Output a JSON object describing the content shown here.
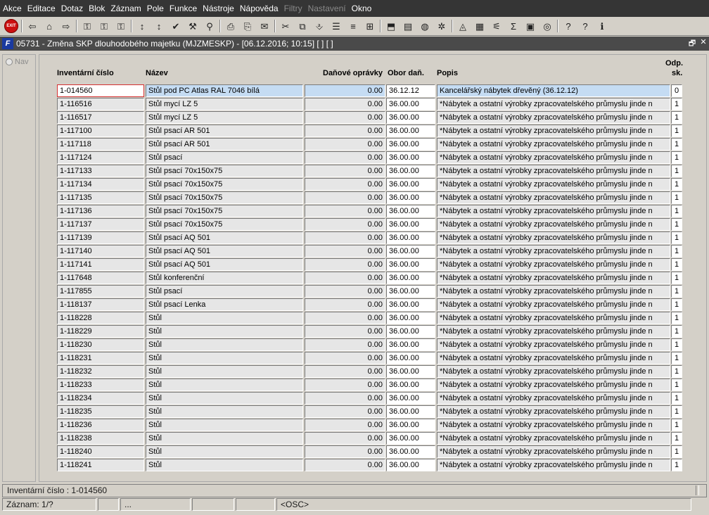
{
  "menu": [
    {
      "label": "Akce",
      "enabled": true
    },
    {
      "label": "Editace",
      "enabled": true
    },
    {
      "label": "Dotaz",
      "enabled": true
    },
    {
      "label": "Blok",
      "enabled": true
    },
    {
      "label": "Záznam",
      "enabled": true
    },
    {
      "label": "Pole",
      "enabled": true
    },
    {
      "label": "Funkce",
      "enabled": true
    },
    {
      "label": "Nástroje",
      "enabled": true
    },
    {
      "label": "Nápověda",
      "enabled": true
    },
    {
      "label": "Filtry",
      "enabled": false
    },
    {
      "label": "Nastavení",
      "enabled": false
    },
    {
      "label": "Okno",
      "enabled": true
    }
  ],
  "toolbar": {
    "exit_label": "EXIT",
    "icons": [
      "save-icon",
      "save-exit-icon",
      "clear-icon",
      "query-icon",
      "execute-query-icon",
      "cancel-query-icon",
      "sort-asc-icon",
      "sort-desc-icon",
      "check-icon",
      "wrench-icon",
      "filter-icon",
      "print-icon",
      "print-preview-icon",
      "mail-icon",
      "cut-icon",
      "copy-icon",
      "paste-icon",
      "insert-icon",
      "list-icon",
      "tree-icon",
      "export-icon",
      "document-icon",
      "globe-icon",
      "settings-icon",
      "eye-icon",
      "calendar-icon",
      "chart-icon",
      "sum-icon",
      "excel-icon",
      "web-icon",
      "help-icon",
      "whats-this-icon",
      "info-icon"
    ],
    "glyphs": [
      "⇦",
      "⌂",
      "⇨",
      "⚿",
      "⚿",
      "⚿",
      "↕",
      "↕",
      "✔",
      "⚒",
      "⚲",
      "⎙",
      "⎘",
      "✉",
      "✂",
      "⧉",
      "⎀",
      "☰",
      "≡",
      "⊞",
      "⬒",
      "▤",
      "◍",
      "✲",
      "◬",
      "▦",
      "⚟",
      "Σ",
      "▣",
      "◎",
      "?",
      "?",
      "ℹ"
    ]
  },
  "window": {
    "title": "05731 - Změna SKP dlouhodobého majetku (MJZMESKP) - [06.12.2016; 10:15]  [ ]  [ ]",
    "restore_glyph": "🗗",
    "close_glyph": "✕"
  },
  "nav": {
    "label": "Nav"
  },
  "columns": {
    "inv": "Inventární číslo",
    "name": "Název",
    "dep": "Daňové oprávky",
    "obor": "Obor daň.",
    "popis": "Popis",
    "odp_line1": "Odp.",
    "odp_line2": "sk."
  },
  "rows": [
    {
      "inv": "1-014560",
      "name": "Stůl pod PC Atlas RAL 7046 bílá",
      "dep": "0.00",
      "obor": "36.12.12",
      "popis": "Kancelářský nábytek dřevěný (36.12.12)",
      "odp": "0"
    },
    {
      "inv": "1-116516",
      "name": "Stůl mycí LZ 5",
      "dep": "0.00",
      "obor": "36.00.00",
      "popis": "*Nábytek a ostatní výrobky zpracovatelského průmyslu jinde n",
      "odp": "1"
    },
    {
      "inv": "1-116517",
      "name": "Stůl mycí LZ 5",
      "dep": "0.00",
      "obor": "36.00.00",
      "popis": "*Nábytek a ostatní výrobky zpracovatelského průmyslu jinde n",
      "odp": "1"
    },
    {
      "inv": "1-117100",
      "name": "Stůl psací AR 501",
      "dep": "0.00",
      "obor": "36.00.00",
      "popis": "*Nábytek a ostatní výrobky zpracovatelského průmyslu jinde n",
      "odp": "1"
    },
    {
      "inv": "1-117118",
      "name": "Stůl psací AR 501",
      "dep": "0.00",
      "obor": "36.00.00",
      "popis": "*Nábytek a ostatní výrobky zpracovatelského průmyslu jinde n",
      "odp": "1"
    },
    {
      "inv": "1-117124",
      "name": "Stůl psací",
      "dep": "0.00",
      "obor": "36.00.00",
      "popis": "*Nábytek a ostatní výrobky zpracovatelského průmyslu jinde n",
      "odp": "1"
    },
    {
      "inv": "1-117133",
      "name": "Stůl psací 70x150x75",
      "dep": "0.00",
      "obor": "36.00.00",
      "popis": "*Nábytek a ostatní výrobky zpracovatelského průmyslu jinde n",
      "odp": "1"
    },
    {
      "inv": "1-117134",
      "name": "Stůl psací 70x150x75",
      "dep": "0.00",
      "obor": "36.00.00",
      "popis": "*Nábytek a ostatní výrobky zpracovatelského průmyslu jinde n",
      "odp": "1"
    },
    {
      "inv": "1-117135",
      "name": "Stůl psací 70x150x75",
      "dep": "0.00",
      "obor": "36.00.00",
      "popis": "*Nábytek a ostatní výrobky zpracovatelského průmyslu jinde n",
      "odp": "1"
    },
    {
      "inv": "1-117136",
      "name": "Stůl psací 70x150x75",
      "dep": "0.00",
      "obor": "36.00.00",
      "popis": "*Nábytek a ostatní výrobky zpracovatelského průmyslu jinde n",
      "odp": "1"
    },
    {
      "inv": "1-117137",
      "name": "Stůl psací 70x150x75",
      "dep": "0.00",
      "obor": "36.00.00",
      "popis": "*Nábytek a ostatní výrobky zpracovatelského průmyslu jinde n",
      "odp": "1"
    },
    {
      "inv": "1-117139",
      "name": "Stůl psací AQ 501",
      "dep": "0.00",
      "obor": "36.00.00",
      "popis": "*Nábytek a ostatní výrobky zpracovatelského průmyslu jinde n",
      "odp": "1"
    },
    {
      "inv": "1-117140",
      "name": "Stůl psací AQ 501",
      "dep": "0.00",
      "obor": "36.00.00",
      "popis": "*Nábytek a ostatní výrobky zpracovatelského průmyslu jinde n",
      "odp": "1"
    },
    {
      "inv": "1-117141",
      "name": "Stůl psací AQ 501",
      "dep": "0.00",
      "obor": "36.00.00",
      "popis": "*Nábytek a ostatní výrobky zpracovatelského průmyslu jinde n",
      "odp": "1"
    },
    {
      "inv": "1-117648",
      "name": "Stůl konferenční",
      "dep": "0.00",
      "obor": "36.00.00",
      "popis": "*Nábytek a ostatní výrobky zpracovatelského průmyslu jinde n",
      "odp": "1"
    },
    {
      "inv": "1-117855",
      "name": "Stůl psací",
      "dep": "0.00",
      "obor": "36.00.00",
      "popis": "*Nábytek a ostatní výrobky zpracovatelského průmyslu jinde n",
      "odp": "1"
    },
    {
      "inv": "1-118137",
      "name": "Stůl psací Lenka",
      "dep": "0.00",
      "obor": "36.00.00",
      "popis": "*Nábytek a ostatní výrobky zpracovatelského průmyslu jinde n",
      "odp": "1"
    },
    {
      "inv": "1-118228",
      "name": "Stůl",
      "dep": "0.00",
      "obor": "36.00.00",
      "popis": "*Nábytek a ostatní výrobky zpracovatelského průmyslu jinde n",
      "odp": "1"
    },
    {
      "inv": "1-118229",
      "name": "Stůl",
      "dep": "0.00",
      "obor": "36.00.00",
      "popis": "*Nábytek a ostatní výrobky zpracovatelského průmyslu jinde n",
      "odp": "1"
    },
    {
      "inv": "1-118230",
      "name": "Stůl",
      "dep": "0.00",
      "obor": "36.00.00",
      "popis": "*Nábytek a ostatní výrobky zpracovatelského průmyslu jinde n",
      "odp": "1"
    },
    {
      "inv": "1-118231",
      "name": "Stůl",
      "dep": "0.00",
      "obor": "36.00.00",
      "popis": "*Nábytek a ostatní výrobky zpracovatelského průmyslu jinde n",
      "odp": "1"
    },
    {
      "inv": "1-118232",
      "name": "Stůl",
      "dep": "0.00",
      "obor": "36.00.00",
      "popis": "*Nábytek a ostatní výrobky zpracovatelského průmyslu jinde n",
      "odp": "1"
    },
    {
      "inv": "1-118233",
      "name": "Stůl",
      "dep": "0.00",
      "obor": "36.00.00",
      "popis": "*Nábytek a ostatní výrobky zpracovatelského průmyslu jinde n",
      "odp": "1"
    },
    {
      "inv": "1-118234",
      "name": "Stůl",
      "dep": "0.00",
      "obor": "36.00.00",
      "popis": "*Nábytek a ostatní výrobky zpracovatelského průmyslu jinde n",
      "odp": "1"
    },
    {
      "inv": "1-118235",
      "name": "Stůl",
      "dep": "0.00",
      "obor": "36.00.00",
      "popis": "*Nábytek a ostatní výrobky zpracovatelského průmyslu jinde n",
      "odp": "1"
    },
    {
      "inv": "1-118236",
      "name": "Stůl",
      "dep": "0.00",
      "obor": "36.00.00",
      "popis": "*Nábytek a ostatní výrobky zpracovatelského průmyslu jinde n",
      "odp": "1"
    },
    {
      "inv": "1-118238",
      "name": "Stůl",
      "dep": "0.00",
      "obor": "36.00.00",
      "popis": "*Nábytek a ostatní výrobky zpracovatelského průmyslu jinde n",
      "odp": "1"
    },
    {
      "inv": "1-118240",
      "name": "Stůl",
      "dep": "0.00",
      "obor": "36.00.00",
      "popis": "*Nábytek a ostatní výrobky zpracovatelského průmyslu jinde n",
      "odp": "1"
    },
    {
      "inv": "1-118241",
      "name": "Stůl",
      "dep": "0.00",
      "obor": "36.00.00",
      "popis": "*Nábytek a ostatní výrobky zpracovatelského průmyslu jinde n",
      "odp": "1"
    }
  ],
  "status": {
    "field_info": "Inventární číslo : 1-014560",
    "record": "Záznam: 1/?",
    "seg2": "",
    "seg3": "...",
    "seg4": "",
    "seg5": "",
    "mode": "<OSC>"
  },
  "colors": {
    "menubar": "#353535",
    "titlebar": "#4a4a4a",
    "selected_row": "#c5dcf3",
    "focus_border": "#d43030"
  }
}
